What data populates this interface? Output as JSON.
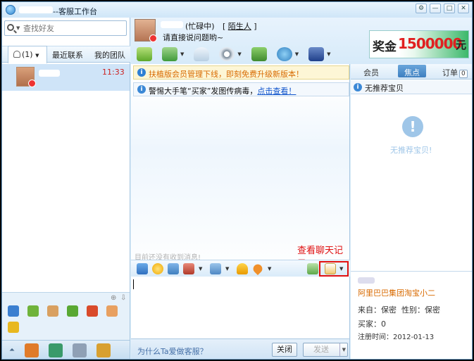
{
  "window": {
    "title": "--客服工作台",
    "controls": [
      "⚙",
      "—",
      "□",
      "✕"
    ]
  },
  "left": {
    "search_placeholder": "查找好友",
    "tabs": [
      {
        "label": "(1)",
        "caret": "▼"
      },
      {
        "label": "最近联系"
      },
      {
        "label": "我的团队"
      }
    ],
    "contacts": [
      {
        "time": "11:33"
      }
    ]
  },
  "header": {
    "status": "(忙碌中)",
    "stranger_label": "[ 陌生人 ]",
    "stranger_text": "陌生人",
    "signature": "请直接说问题哟~",
    "ad_label": "奖金",
    "ad_amount": "1500000",
    "ad_unit": "元"
  },
  "chat": {
    "notice1": "扶植版会员管理下线，即刻免费升级新版本！",
    "notice2_text": "警惕大手笔“买家”发图传病毒，",
    "notice2_link": "点击查看！",
    "empty_text": "目前还没有收到消息!",
    "annotation": "查看聊天记录"
  },
  "bottom": {
    "why_link": "为什么Ta爱做客服？",
    "close_label": "关闭",
    "send_label": "发送"
  },
  "right": {
    "tabs": [
      {
        "label": "会员"
      },
      {
        "label": "焦点"
      },
      {
        "label": "订单",
        "badge": "0"
      }
    ],
    "info_title": "无推荐宝贝",
    "empty_text": "无推荐宝贝!",
    "alert_symbol": "!",
    "customer": {
      "name": "阿里巴巴集团淘宝小二",
      "from_label": "来自：保密",
      "gender_label": "性别：保密",
      "buyer_label": "买家：0",
      "reg_label": "注册时间：2012-01-13"
    }
  },
  "colors": {
    "accent": "#3d7fc0",
    "alert_red": "#e01010",
    "notice_orange": "#d86a00",
    "time_red": "#c22222"
  }
}
